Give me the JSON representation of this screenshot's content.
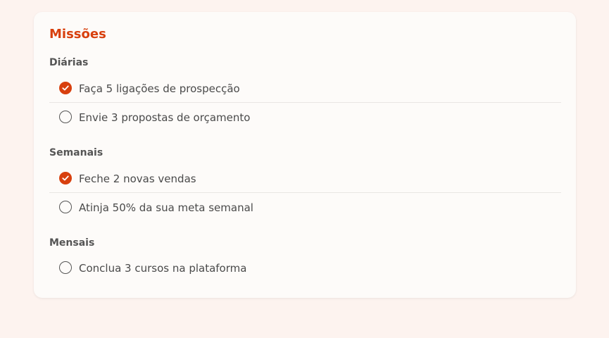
{
  "missions": {
    "title": "Missões",
    "groups": [
      {
        "label": "Diárias",
        "items": [
          {
            "label": "Faça 5 ligações de prospecção",
            "completed": true
          },
          {
            "label": "Envie 3 propostas de orçamento",
            "completed": false
          }
        ]
      },
      {
        "label": "Semanais",
        "items": [
          {
            "label": "Feche 2 novas vendas",
            "completed": true
          },
          {
            "label": "Atinja 50% da sua meta semanal",
            "completed": false
          }
        ]
      },
      {
        "label": "Mensais",
        "items": [
          {
            "label": "Conclua 3 cursos na plataforma",
            "completed": false
          }
        ]
      }
    ]
  },
  "colors": {
    "accent": "#d8400e",
    "background": "#fdf3ef",
    "card": "#fdfbf9",
    "text": "#4a4a4a"
  },
  "icons": {
    "completed": "check-circle-icon",
    "pending": "empty-circle-icon"
  }
}
